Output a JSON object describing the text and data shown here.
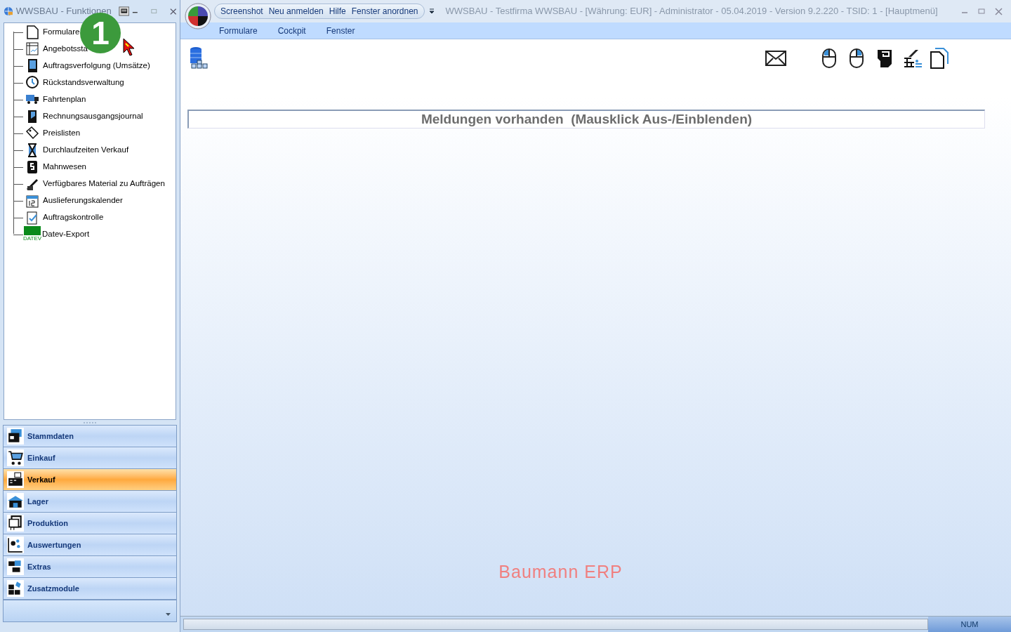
{
  "side_window": {
    "title": "WWSBAU - Funktionen"
  },
  "tree": [
    {
      "label": "Formulare"
    },
    {
      "label": "Angebotssta"
    },
    {
      "label": "Auftragsverfolgung (Umsätze)"
    },
    {
      "label": "Rückstandsverwaltung"
    },
    {
      "label": "Fahrtenplan"
    },
    {
      "label": "Rechnungsausgangsjournal"
    },
    {
      "label": "Preislisten"
    },
    {
      "label": "Durchlaufzeiten Verkauf"
    },
    {
      "label": "Mahnwesen"
    },
    {
      "label": "Verfügbares Material zu Aufträgen"
    },
    {
      "label": "Auslieferungskalender"
    },
    {
      "label": "Auftragskontrolle"
    },
    {
      "label": "Datev-Export",
      "icon_text": "DATEV"
    }
  ],
  "annotation_badge": "1",
  "nav": [
    {
      "label": "Stammdaten",
      "selected": false
    },
    {
      "label": "Einkauf",
      "selected": false
    },
    {
      "label": "Verkauf",
      "selected": true
    },
    {
      "label": "Lager",
      "selected": false
    },
    {
      "label": "Produktion",
      "selected": false
    },
    {
      "label": "Auswertungen",
      "selected": false
    },
    {
      "label": "Extras",
      "selected": false
    },
    {
      "label": "Zusatzmodule",
      "selected": false
    }
  ],
  "quick_access": [
    "Screenshot",
    "Neu anmelden",
    "Hilfe",
    "Fenster anordnen"
  ],
  "window": {
    "title": "WWSBAU - Testfirma WWSBAU - [Währung: EUR] - Administrator - 05.04.2019 - Version 9.2.220 - TSID: 1  - [Hauptmenü]"
  },
  "menu": [
    "Formulare",
    "Cockpit",
    "Fenster"
  ],
  "message_bar": "Meldungen vorhanden  (Mausklick Aus-/Einblenden)",
  "watermark_text": "Baumann ERP",
  "status_bar": {
    "num": "NUM"
  }
}
